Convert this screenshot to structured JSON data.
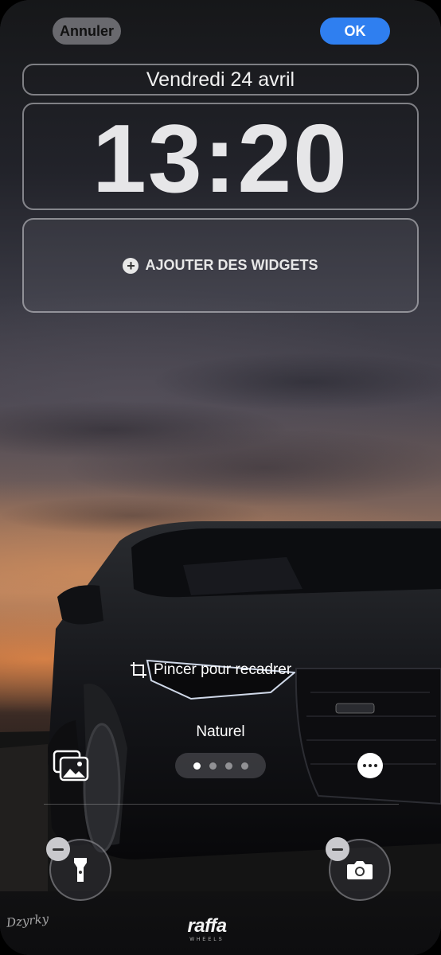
{
  "header": {
    "cancel_label": "Annuler",
    "ok_label": "OK"
  },
  "lockscreen": {
    "date": "Vendredi 24 avril",
    "time": "13:20",
    "add_widgets_label": "AJOUTER DES WIDGETS"
  },
  "wallpaper": {
    "crop_hint": "Pincer pour recadrer",
    "style_name": "Naturel",
    "style_pages": 4,
    "active_style_index": 0,
    "signature_text": "Dzyrky",
    "brand_name": "raffa",
    "brand_sub": "WHEELS"
  },
  "quick_actions": {
    "left_icon": "flashlight-icon",
    "right_icon": "camera-icon"
  },
  "colors": {
    "accent": "#2f7ff0",
    "cancel_bg": "#78787d"
  }
}
